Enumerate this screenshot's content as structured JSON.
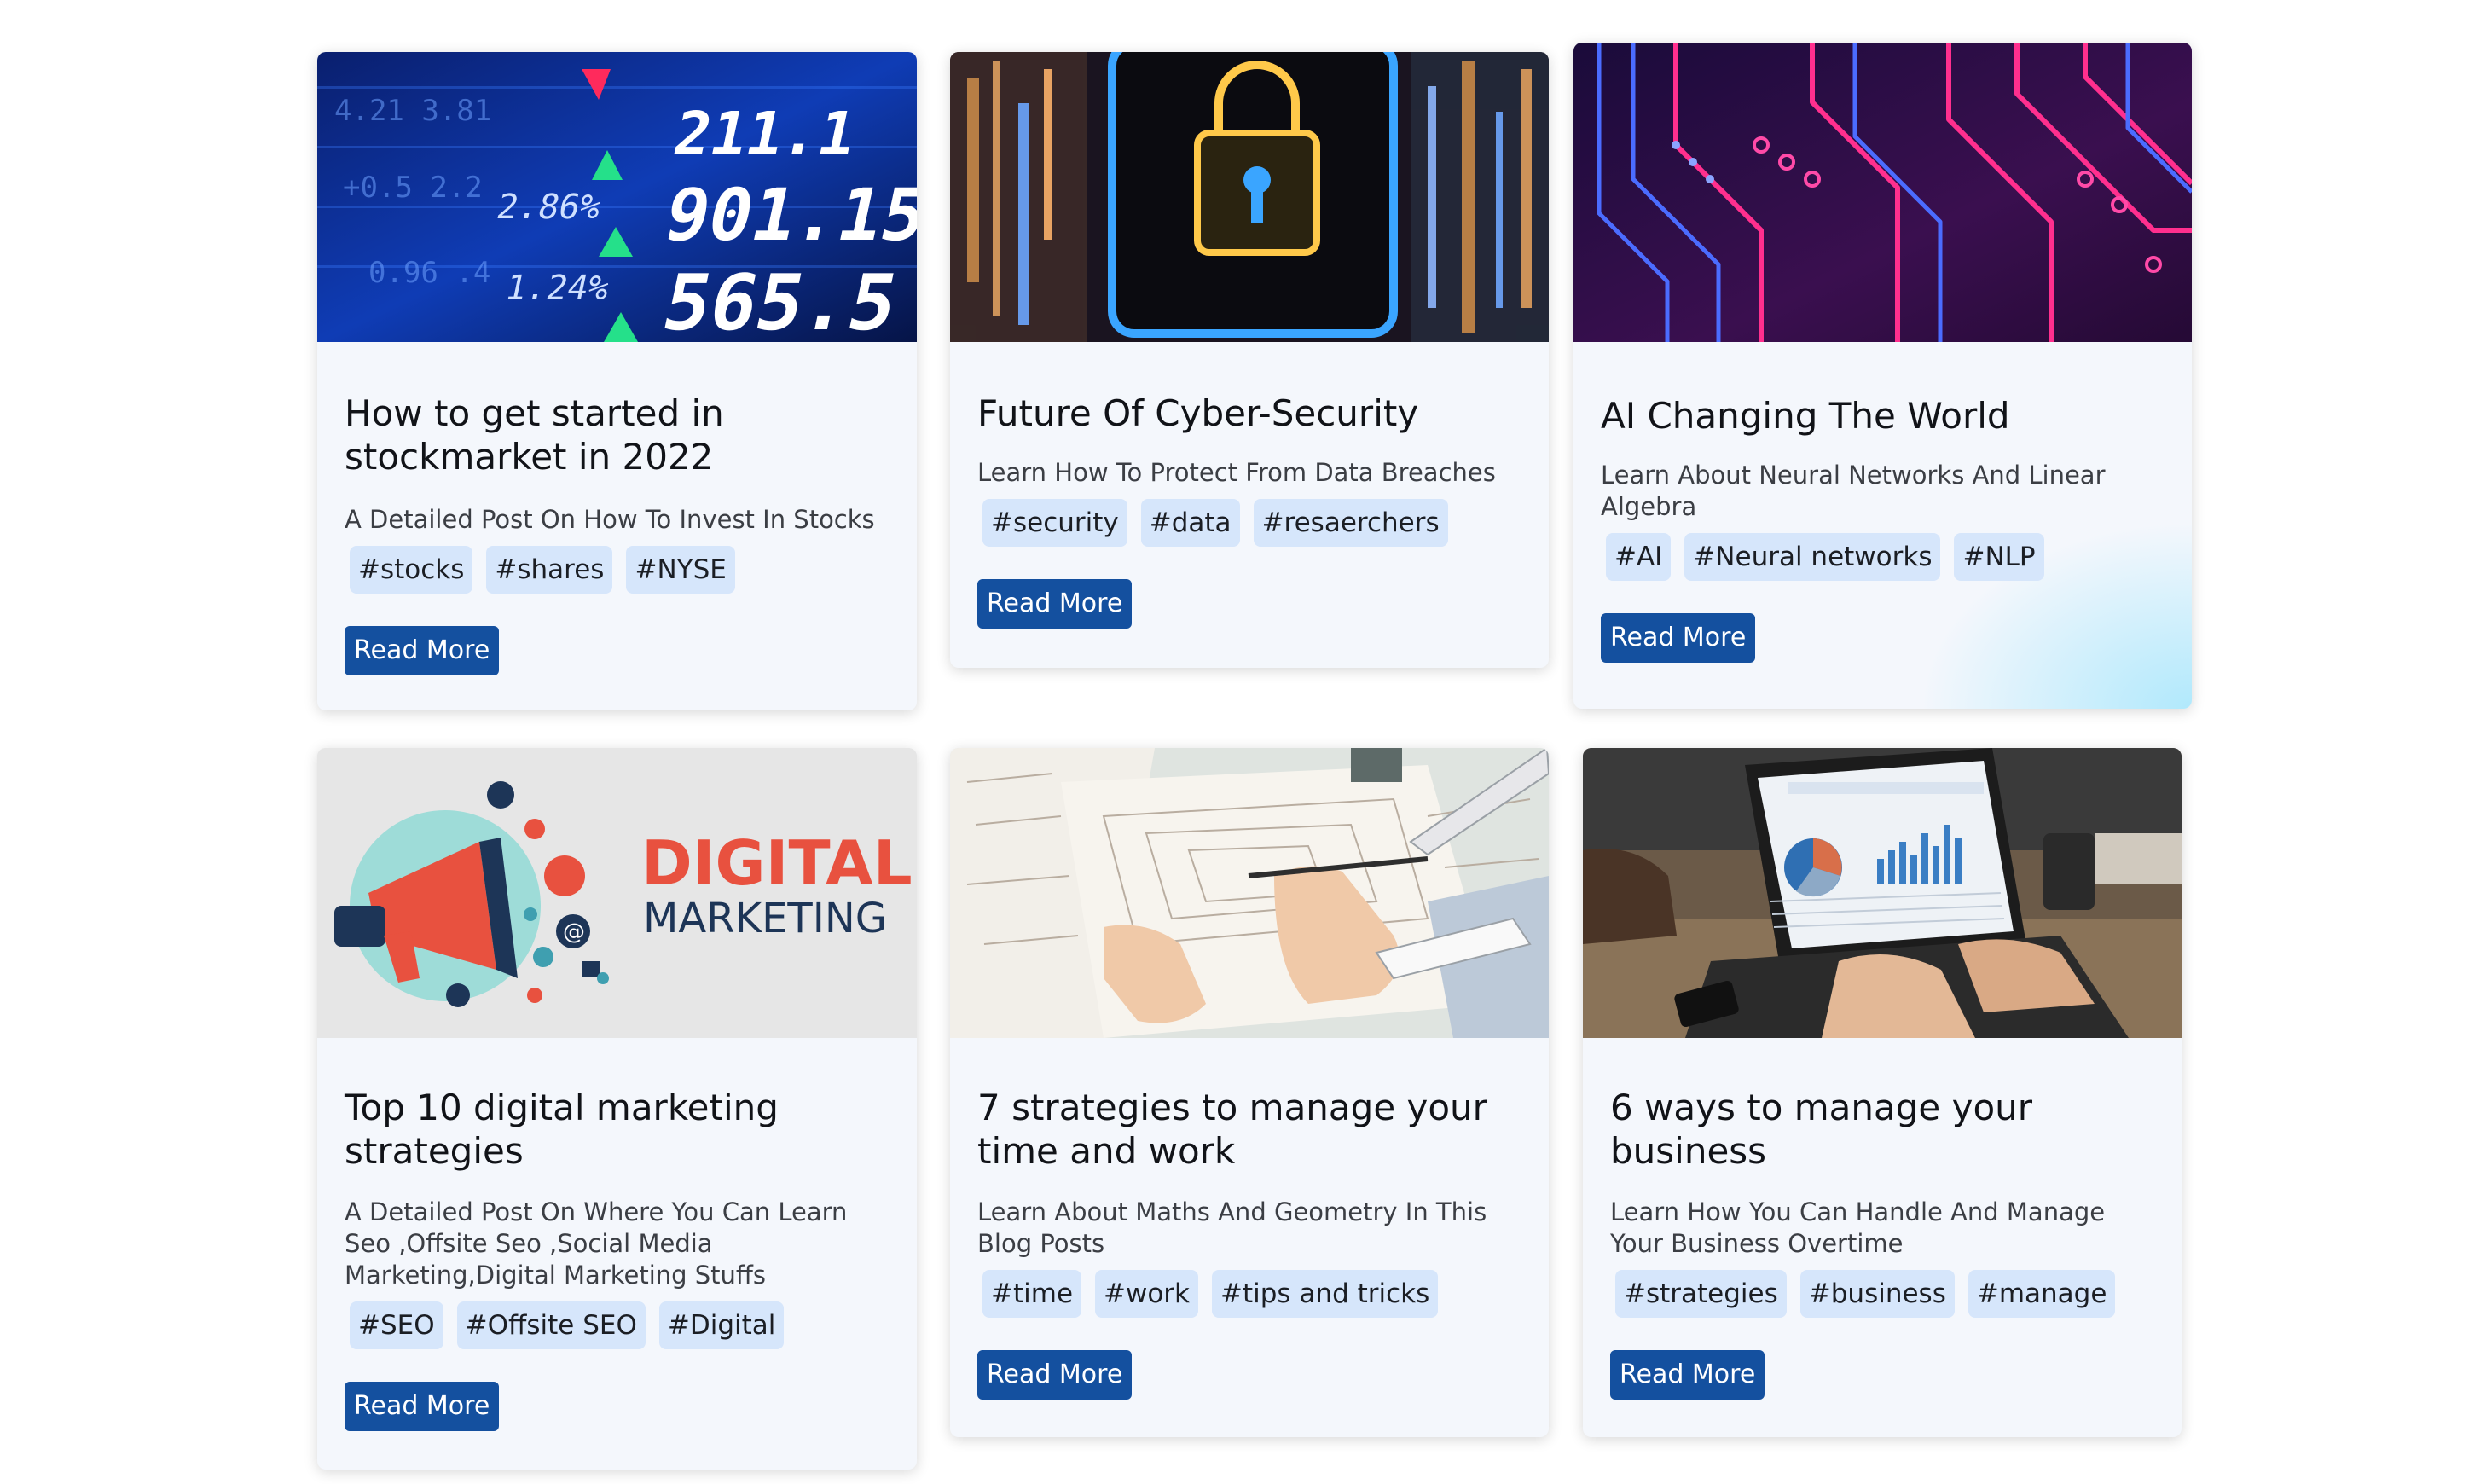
{
  "cards": [
    {
      "title": "How to get started in stockmarket in 2022",
      "description": "A Detailed Post On How To Invest In Stocks",
      "tags": [
        "#stocks",
        "#shares",
        "#NYSE"
      ],
      "button": "Read More",
      "image": {
        "name": "stock-ticker-image",
        "numbers": [
          "211.1",
          "901.15",
          "565.5"
        ],
        "percents": [
          "2.86%",
          "1.24%"
        ]
      }
    },
    {
      "title": "Future Of Cyber-Security",
      "description": "Learn How To Protect From Data Breaches",
      "tags": [
        "#security",
        "#data",
        "#resaerchers"
      ],
      "button": "Read More",
      "image": {
        "name": "cyber-lock-image"
      }
    },
    {
      "title": "AI Changing The World",
      "description": "Learn About Neural Networks And Linear Algebra",
      "tags": [
        "#AI",
        "#Neural networks",
        "#NLP"
      ],
      "button": "Read More",
      "image": {
        "name": "circuit-board-image"
      }
    },
    {
      "title": "Top 10 digital marketing strategies",
      "description": "A Detailed Post On Where You Can Learn Seo ,Offsite Seo ,Social Media Marketing,Digital Marketing Stuffs",
      "tags": [
        "#SEO",
        "#Offsite SEO",
        "#Digital"
      ],
      "button": "Read More",
      "image": {
        "name": "digital-marketing-image",
        "line1": "DIGITAL",
        "line2": "MARKETING"
      }
    },
    {
      "title": "7 strategies to manage your time and work",
      "description": "Learn About Maths And Geometry In This Blog Posts",
      "tags": [
        "#time",
        "#work",
        "#tips and tricks"
      ],
      "button": "Read More",
      "image": {
        "name": "architect-sketch-image"
      }
    },
    {
      "title": "6 ways to manage your business",
      "description": "Learn How You Can Handle And Manage Your Business Overtime",
      "tags": [
        "#strategies",
        "#business",
        "#manage"
      ],
      "button": "Read More",
      "image": {
        "name": "laptop-dashboard-image"
      }
    }
  ],
  "colors": {
    "card_bg": "#f4f7fc",
    "tag_bg": "#d6e6fb",
    "button_bg": "#14509f",
    "title": "#111318",
    "marketing_red": "#e8513f",
    "marketing_navy": "#1d3557"
  }
}
